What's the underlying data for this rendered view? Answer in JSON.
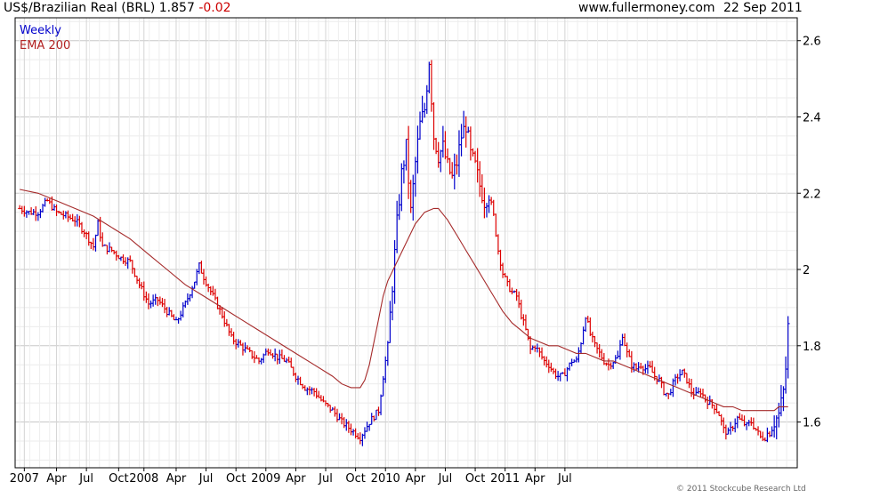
{
  "header": {
    "title": "US$/Brazilian Real (BRL)",
    "last": "1.857",
    "change": "-0.02",
    "site": "www.fullermoney.com",
    "date": "22 Sep 2011"
  },
  "footer": {
    "copyright": "© 2011 Stockcube Research Ltd"
  },
  "colors": {
    "up": "#0000cc",
    "down": "#dd0000",
    "ema": "#a52a2a",
    "grid": "#dcdcdc",
    "axis": "#000000"
  },
  "chart_data": {
    "type": "line",
    "series": [
      {
        "name": "Weekly",
        "points": [
          [
            0,
            2.16
          ],
          [
            4,
            2.15
          ],
          [
            8,
            2.15
          ],
          [
            12,
            2.18
          ],
          [
            16,
            2.15
          ],
          [
            20,
            2.14
          ],
          [
            24,
            2.13
          ],
          [
            28,
            2.1
          ],
          [
            32,
            2.06
          ],
          [
            34,
            2.12
          ],
          [
            36,
            2.06
          ],
          [
            40,
            2.05
          ],
          [
            44,
            2.03
          ],
          [
            48,
            2.02
          ],
          [
            52,
            1.96
          ],
          [
            56,
            1.91
          ],
          [
            60,
            1.92
          ],
          [
            64,
            1.89
          ],
          [
            68,
            1.86
          ],
          [
            72,
            1.91
          ],
          [
            76,
            1.97
          ],
          [
            78,
            2.01
          ],
          [
            80,
            1.98
          ],
          [
            84,
            1.93
          ],
          [
            88,
            1.88
          ],
          [
            92,
            1.82
          ],
          [
            96,
            1.8
          ],
          [
            100,
            1.78
          ],
          [
            104,
            1.76
          ],
          [
            108,
            1.79
          ],
          [
            112,
            1.77
          ],
          [
            116,
            1.76
          ],
          [
            120,
            1.72
          ],
          [
            124,
            1.69
          ],
          [
            128,
            1.68
          ],
          [
            132,
            1.65
          ],
          [
            136,
            1.63
          ],
          [
            140,
            1.6
          ],
          [
            144,
            1.58
          ],
          [
            148,
            1.56
          ],
          [
            152,
            1.6
          ],
          [
            156,
            1.63
          ],
          [
            158,
            1.72
          ],
          [
            160,
            1.8
          ],
          [
            162,
            1.96
          ],
          [
            164,
            2.12
          ],
          [
            166,
            2.25
          ],
          [
            168,
            2.32
          ],
          [
            170,
            2.15
          ],
          [
            172,
            2.28
          ],
          [
            174,
            2.38
          ],
          [
            176,
            2.42
          ],
          [
            178,
            2.55
          ],
          [
            180,
            2.35
          ],
          [
            182,
            2.3
          ],
          [
            184,
            2.32
          ],
          [
            186,
            2.27
          ],
          [
            188,
            2.24
          ],
          [
            190,
            2.28
          ],
          [
            192,
            2.35
          ],
          [
            194,
            2.38
          ],
          [
            196,
            2.3
          ],
          [
            198,
            2.27
          ],
          [
            200,
            2.22
          ],
          [
            202,
            2.18
          ],
          [
            204,
            2.2
          ],
          [
            206,
            2.14
          ],
          [
            208,
            2.05
          ],
          [
            210,
            1.99
          ],
          [
            212,
            1.96
          ],
          [
            214,
            1.94
          ],
          [
            216,
            1.93
          ],
          [
            218,
            1.88
          ],
          [
            220,
            1.84
          ],
          [
            222,
            1.79
          ],
          [
            224,
            1.8
          ],
          [
            226,
            1.78
          ],
          [
            228,
            1.76
          ],
          [
            230,
            1.75
          ],
          [
            232,
            1.73
          ],
          [
            234,
            1.72
          ],
          [
            236,
            1.72
          ],
          [
            238,
            1.74
          ],
          [
            240,
            1.76
          ],
          [
            242,
            1.76
          ],
          [
            244,
            1.81
          ],
          [
            246,
            1.88
          ],
          [
            248,
            1.83
          ],
          [
            250,
            1.8
          ],
          [
            252,
            1.78
          ],
          [
            254,
            1.76
          ],
          [
            256,
            1.75
          ],
          [
            258,
            1.76
          ],
          [
            260,
            1.77
          ],
          [
            262,
            1.83
          ],
          [
            264,
            1.78
          ],
          [
            266,
            1.75
          ],
          [
            268,
            1.74
          ],
          [
            270,
            1.75
          ],
          [
            272,
            1.74
          ],
          [
            274,
            1.74
          ],
          [
            276,
            1.72
          ],
          [
            278,
            1.71
          ],
          [
            280,
            1.68
          ],
          [
            282,
            1.67
          ],
          [
            284,
            1.7
          ],
          [
            286,
            1.72
          ],
          [
            288,
            1.73
          ],
          [
            290,
            1.71
          ],
          [
            292,
            1.68
          ],
          [
            294,
            1.67
          ],
          [
            296,
            1.68
          ],
          [
            298,
            1.66
          ],
          [
            300,
            1.65
          ],
          [
            302,
            1.64
          ],
          [
            304,
            1.62
          ],
          [
            306,
            1.58
          ],
          [
            308,
            1.57
          ],
          [
            310,
            1.59
          ],
          [
            312,
            1.61
          ],
          [
            314,
            1.6
          ],
          [
            316,
            1.59
          ],
          [
            318,
            1.6
          ],
          [
            320,
            1.58
          ],
          [
            322,
            1.56
          ],
          [
            324,
            1.56
          ],
          [
            326,
            1.58
          ],
          [
            328,
            1.6
          ],
          [
            330,
            1.62
          ],
          [
            332,
            1.68
          ],
          [
            333,
            1.74
          ],
          [
            334,
            1.85
          ]
        ]
      },
      {
        "name": "EMA 200",
        "points": [
          [
            0,
            2.21
          ],
          [
            8,
            2.2
          ],
          [
            16,
            2.18
          ],
          [
            24,
            2.16
          ],
          [
            32,
            2.14
          ],
          [
            40,
            2.11
          ],
          [
            48,
            2.08
          ],
          [
            56,
            2.04
          ],
          [
            64,
            2.0
          ],
          [
            72,
            1.96
          ],
          [
            80,
            1.93
          ],
          [
            88,
            1.9
          ],
          [
            96,
            1.87
          ],
          [
            104,
            1.84
          ],
          [
            112,
            1.81
          ],
          [
            120,
            1.78
          ],
          [
            128,
            1.75
          ],
          [
            136,
            1.72
          ],
          [
            140,
            1.7
          ],
          [
            144,
            1.69
          ],
          [
            148,
            1.69
          ],
          [
            150,
            1.71
          ],
          [
            152,
            1.75
          ],
          [
            154,
            1.81
          ],
          [
            156,
            1.87
          ],
          [
            158,
            1.93
          ],
          [
            160,
            1.97
          ],
          [
            164,
            2.02
          ],
          [
            168,
            2.07
          ],
          [
            172,
            2.12
          ],
          [
            176,
            2.15
          ],
          [
            180,
            2.16
          ],
          [
            182,
            2.16
          ],
          [
            186,
            2.13
          ],
          [
            190,
            2.09
          ],
          [
            194,
            2.05
          ],
          [
            198,
            2.01
          ],
          [
            202,
            1.97
          ],
          [
            206,
            1.93
          ],
          [
            210,
            1.89
          ],
          [
            214,
            1.86
          ],
          [
            218,
            1.84
          ],
          [
            222,
            1.82
          ],
          [
            226,
            1.81
          ],
          [
            230,
            1.8
          ],
          [
            234,
            1.8
          ],
          [
            238,
            1.79
          ],
          [
            242,
            1.78
          ],
          [
            246,
            1.78
          ],
          [
            250,
            1.77
          ],
          [
            254,
            1.76
          ],
          [
            258,
            1.76
          ],
          [
            262,
            1.75
          ],
          [
            266,
            1.74
          ],
          [
            270,
            1.73
          ],
          [
            274,
            1.72
          ],
          [
            278,
            1.71
          ],
          [
            282,
            1.7
          ],
          [
            286,
            1.69
          ],
          [
            290,
            1.68
          ],
          [
            294,
            1.67
          ],
          [
            298,
            1.66
          ],
          [
            302,
            1.65
          ],
          [
            306,
            1.64
          ],
          [
            310,
            1.64
          ],
          [
            314,
            1.63
          ],
          [
            318,
            1.63
          ],
          [
            322,
            1.63
          ],
          [
            324,
            1.63
          ],
          [
            326,
            1.63
          ],
          [
            328,
            1.63
          ],
          [
            330,
            1.64
          ],
          [
            332,
            1.64
          ],
          [
            334,
            1.64
          ]
        ]
      }
    ],
    "x_ticks": [
      {
        "label": "2007",
        "week": 2
      },
      {
        "label": "Apr",
        "week": 16
      },
      {
        "label": "Jul",
        "week": 29
      },
      {
        "label": "Oct",
        "week": 43
      },
      {
        "label": "2008",
        "week": 54
      },
      {
        "label": "Apr",
        "week": 68
      },
      {
        "label": "Jul",
        "week": 81
      },
      {
        "label": "Oct",
        "week": 94
      },
      {
        "label": "2009",
        "week": 107
      },
      {
        "label": "Apr",
        "week": 120
      },
      {
        "label": "Jul",
        "week": 133
      },
      {
        "label": "Oct",
        "week": 146
      },
      {
        "label": "2010",
        "week": 159
      },
      {
        "label": "Apr",
        "week": 172
      },
      {
        "label": "Jul",
        "week": 185
      },
      {
        "label": "Oct",
        "week": 198
      },
      {
        "label": "2011",
        "week": 211
      },
      {
        "label": "Apr",
        "week": 224
      },
      {
        "label": "Jul",
        "week": 237
      }
    ],
    "y_ticks": [
      1.6,
      1.8,
      2,
      2.2,
      2.4,
      2.6
    ],
    "y_tick_labels": [
      "1.6",
      "1.8",
      "2",
      "2.2",
      "2.4",
      "2.6"
    ],
    "ylim": [
      1.48,
      2.66
    ],
    "xlim": [
      -2,
      338
    ],
    "grid": true,
    "legend": "top-left"
  }
}
